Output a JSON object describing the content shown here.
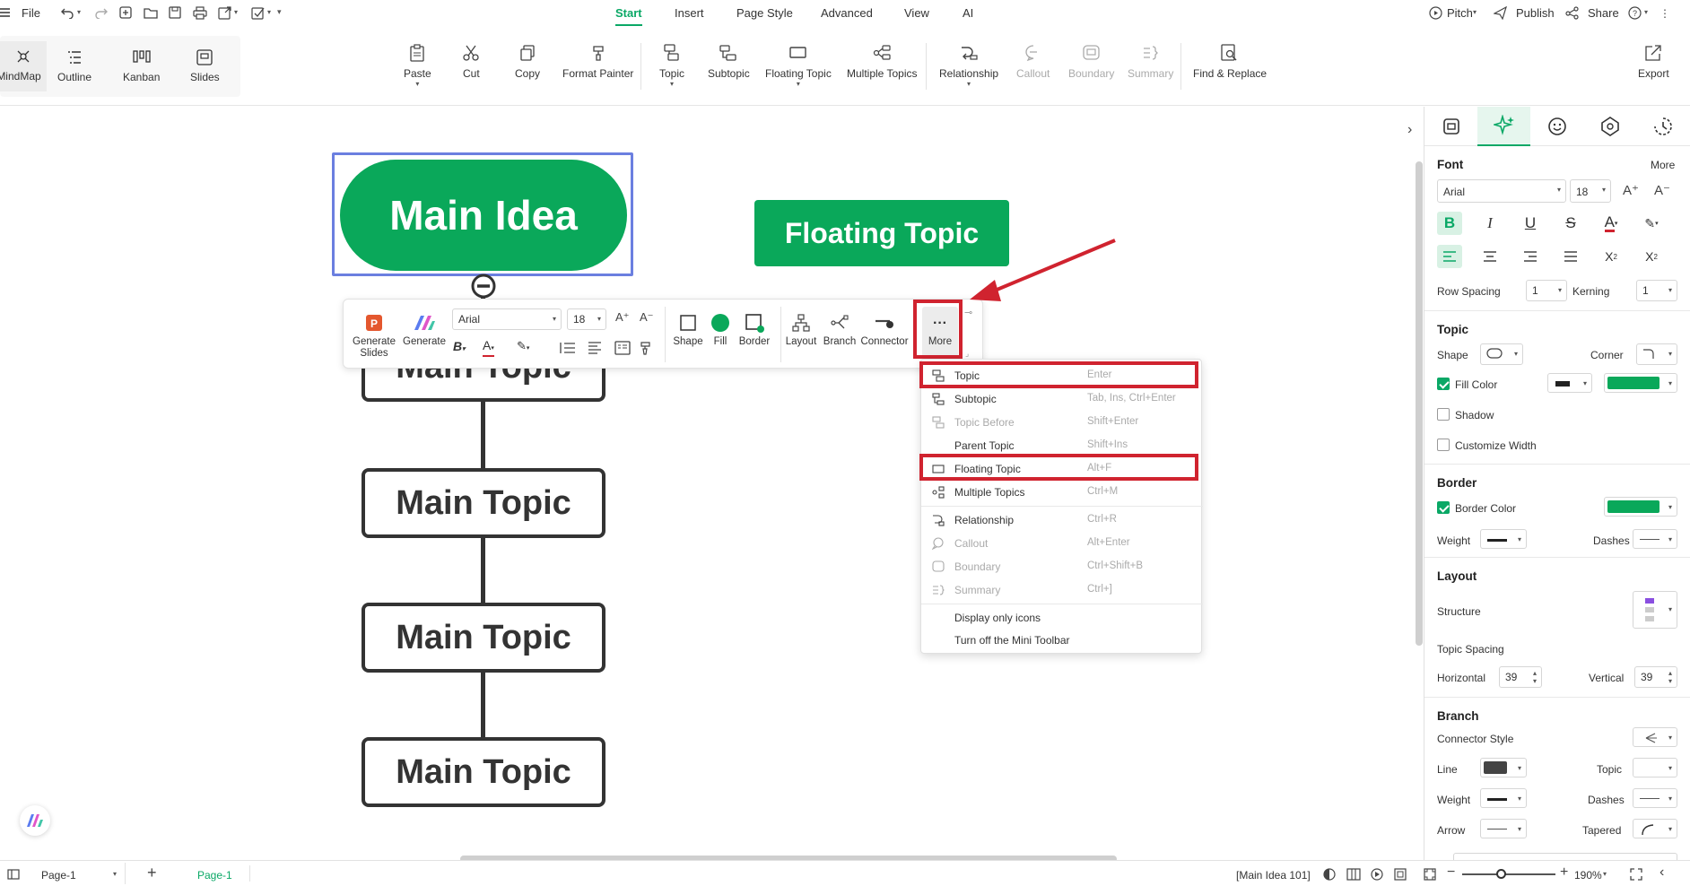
{
  "menu": {
    "file": "File",
    "tabs": [
      "Start",
      "Insert",
      "Page Style",
      "Advanced",
      "View",
      "AI"
    ],
    "active_tab": "Start",
    "right": {
      "pitch": "Pitch",
      "publish": "Publish",
      "share": "Share",
      "help": "?"
    }
  },
  "views": [
    "MindMap",
    "Outline",
    "Kanban",
    "Slides"
  ],
  "ribbon": {
    "paste": "Paste",
    "cut": "Cut",
    "copy": "Copy",
    "format_painter": "Format Painter",
    "topic": "Topic",
    "subtopic": "Subtopic",
    "floating_topic": "Floating Topic",
    "multiple_topics": "Multiple Topics",
    "relationship": "Relationship",
    "callout": "Callout",
    "boundary": "Boundary",
    "summary": "Summary",
    "find_replace": "Find & Replace",
    "export": "Export"
  },
  "canvas": {
    "main_idea": "Main Idea",
    "floating_topic": "Floating Topic",
    "main_topics": [
      "Main Topic",
      "Main Topic",
      "Main Topic",
      "Main Topic"
    ]
  },
  "mini_toolbar": {
    "generate_slides": "Generate Slides",
    "generate": "Generate",
    "font": "Arial",
    "size": "18",
    "shape": "Shape",
    "fill": "Fill",
    "border": "Border",
    "layout": "Layout",
    "branch": "Branch",
    "connector": "Connector",
    "more": "More"
  },
  "context_menu": [
    {
      "label": "Topic",
      "shortcut": "Enter",
      "disabled": false,
      "icon": "topic-icon"
    },
    {
      "label": "Subtopic",
      "shortcut": "Tab, Ins, Ctrl+Enter",
      "disabled": false,
      "icon": "subtopic-icon"
    },
    {
      "label": "Topic Before",
      "shortcut": "Shift+Enter",
      "disabled": true,
      "icon": "topic-before-icon"
    },
    {
      "label": "Parent Topic",
      "shortcut": "Shift+Ins",
      "disabled": false,
      "icon": ""
    },
    {
      "label": "Floating Topic",
      "shortcut": "Alt+F",
      "disabled": false,
      "icon": "floating-topic-icon"
    },
    {
      "label": "Multiple Topics",
      "shortcut": "Ctrl+M",
      "disabled": false,
      "icon": "multiple-topics-icon"
    },
    {
      "label": "Relationship",
      "shortcut": "Ctrl+R",
      "disabled": false,
      "icon": "relationship-icon"
    },
    {
      "label": "Callout",
      "shortcut": "Alt+Enter",
      "disabled": true,
      "icon": "callout-icon"
    },
    {
      "label": "Boundary",
      "shortcut": "Ctrl+Shift+B",
      "disabled": true,
      "icon": "boundary-icon"
    },
    {
      "label": "Summary",
      "shortcut": "Ctrl+]",
      "disabled": true,
      "icon": "summary-icon"
    },
    {
      "label": "Display only icons",
      "shortcut": "",
      "disabled": false,
      "icon": ""
    },
    {
      "label": "Turn off the Mini Toolbar",
      "shortcut": "",
      "disabled": false,
      "icon": ""
    }
  ],
  "panel": {
    "font_heading": "Font",
    "more": "More",
    "font": "Arial",
    "size": "18",
    "row_spacing_label": "Row Spacing",
    "row_spacing": "1",
    "kerning_label": "Kerning",
    "kerning": "1",
    "topic_heading": "Topic",
    "shape_label": "Shape",
    "corner_label": "Corner",
    "fill_color_label": "Fill Color",
    "shadow_label": "Shadow",
    "customize_width_label": "Customize Width",
    "border_heading": "Border",
    "border_color_label": "Border Color",
    "weight_label": "Weight",
    "dashes_label": "Dashes",
    "layout_heading": "Layout",
    "structure_label": "Structure",
    "topic_spacing_label": "Topic Spacing",
    "horizontal_label": "Horizontal",
    "horizontal": "39",
    "vertical_label": "Vertical",
    "vertical": "39",
    "branch_heading": "Branch",
    "connector_style_label": "Connector Style",
    "line_label": "Line",
    "topic_label": "Topic",
    "branch_weight_label": "Weight",
    "branch_dashes_label": "Dashes",
    "arrow_label": "Arrow",
    "tapered_label": "Tapered",
    "fill_color": "#0aa85a",
    "border_color": "#0aa85a",
    "line_color": "#444444"
  },
  "status": {
    "page_select": "Page-1",
    "page_tab": "Page-1",
    "node": "[Main Idea 101]",
    "zoom": "190%"
  },
  "colors": {
    "accent": "#0aa866",
    "highlight": "#d0232f",
    "selection": "#6b7fe0"
  }
}
